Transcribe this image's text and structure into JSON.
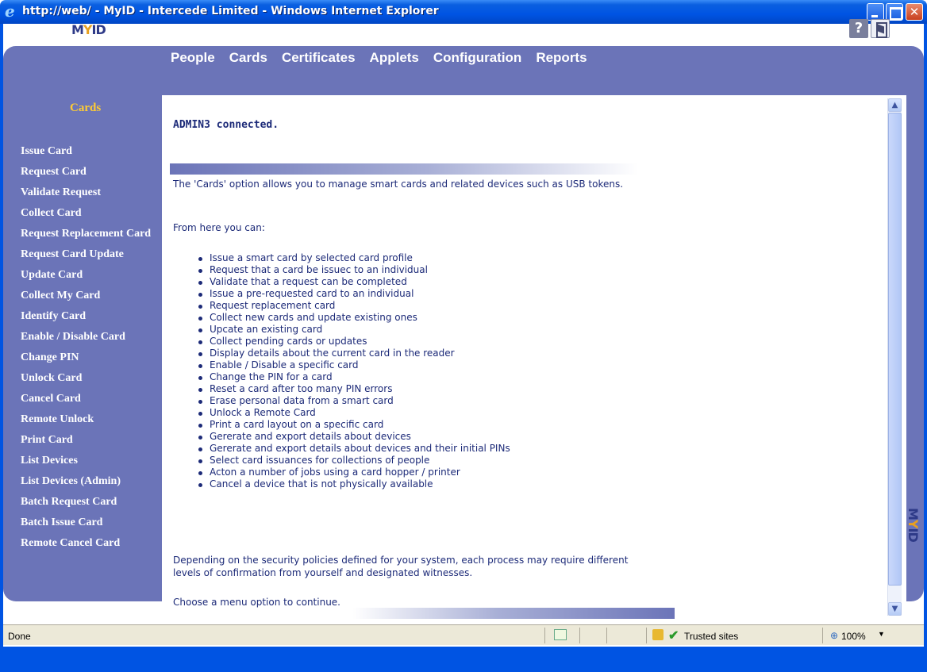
{
  "window": {
    "title": "http://web/ - MyID - Intercede Limited - Windows Internet Explorer"
  },
  "header": {
    "logo": "MYID",
    "help_label": "?"
  },
  "topnav": [
    "People",
    "Cards",
    "Certificates",
    "Applets",
    "Configuration",
    "Reports"
  ],
  "sidebar": {
    "title": "Cards",
    "items": [
      "Issue Card",
      "Request Card",
      "Validate Request",
      "Collect Card",
      "Request Replacement Card",
      "Request Card Update",
      "Update Card",
      "Collect My Card",
      "Identify Card",
      "Enable / Disable Card",
      "Change PIN",
      "Unlock Card",
      "Cancel Card",
      "Remote Unlock",
      "Print Card",
      "List Devices",
      "List Devices (Admin)",
      "Batch Request Card",
      "Batch Issue Card",
      "Remote Cancel Card"
    ]
  },
  "main": {
    "connected": "ADMIN3 connected.",
    "intro": "The 'Cards' option allows you to manage smart cards and related devices such as USB tokens.",
    "from_here": "From here you can:",
    "bullets": [
      "Issue a smart card by selected card profile",
      "Request that a card be issuec to an individual",
      "Validate that a request can be completed",
      "Issue a pre-requested card to an individual",
      "Request replacement card",
      "Collect new cards and update existing ones",
      "Upcate an existing card",
      "Collect pending cards or updates",
      "Display details about the current card in the reader",
      "Enable / Disable a specific card",
      "Change the PIN for a card",
      "Reset a card after too many PIN errors",
      "Erase personal data from a smart card",
      "Unlock a Remote Card",
      "Print a card layout on a specific card",
      "Gererate and export details about devices",
      "Gererate and export details about devices and their initial PINs",
      "Select card issuances for collections of people",
      "Acton a number of jobs using a card hopper / printer",
      "Cancel a device that is not physically available"
    ],
    "policy": "Depending on the security policies defined for your system, each process may require different levels of confirmation from yourself and designated witnesses.",
    "choose": "Choose a menu option to continue."
  },
  "side_logo": "MYID",
  "statusbar": {
    "status": "Done",
    "zone": "Trusted sites",
    "zoom": "100%"
  }
}
